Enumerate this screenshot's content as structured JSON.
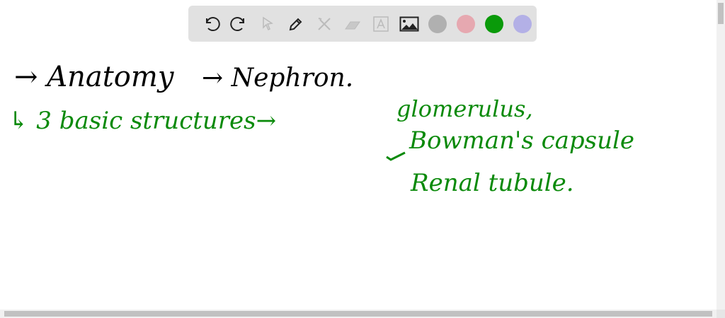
{
  "toolbar": {
    "tools": [
      "undo-icon",
      "redo-icon",
      "pointer-icon",
      "pen-icon",
      "tools-icon",
      "eraser-icon",
      "text-icon",
      "image-icon"
    ],
    "colors": [
      "#b0b0b0",
      "#e6a8b0",
      "#0a9a0a",
      "#b3b0e6"
    ]
  },
  "notes": {
    "line1_a": "→ Anatomy",
    "line1_b": "→ Nephron.",
    "line2": "↳ 3 basic structures→",
    "item1": "glomerulus,",
    "item2": "Bowman's capsule",
    "item3": "Renal tubule."
  },
  "ink": {
    "black": "#000000",
    "green": "#0a8a0a"
  }
}
